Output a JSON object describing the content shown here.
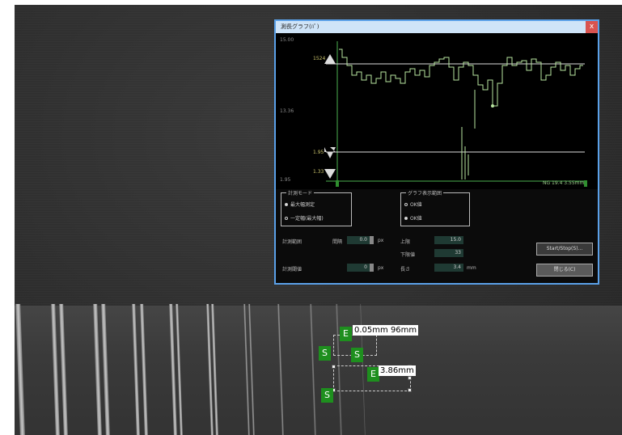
{
  "dialog": {
    "title": "測長グラフ(ﾊﾟ)",
    "close": "x"
  },
  "graph": {
    "y_top": "15.00",
    "y_mid": "13.36",
    "y_bottom": "1.95",
    "marker_upper": "1524",
    "marker_lower_1": "1.95",
    "marker_lower_2": "1.33",
    "status": "NG 19.4  3.55mm"
  },
  "panel": {
    "mode_group": {
      "title": "計測モード",
      "options": [
        "最大幅測定",
        "一定幅(最大幅)"
      ],
      "selected": 0
    },
    "graph_group": {
      "title": "グラフ表示範囲",
      "options": [
        "OK値",
        "OK値"
      ],
      "selected": 1
    },
    "params": {
      "range_label": "計測範囲",
      "interval_label": "間隔",
      "interval_value": "0.0",
      "threshold_label": "計測閾値",
      "threshold_value": "0",
      "unit_px": "px",
      "upper_label": "上限",
      "upper_value": "15.0",
      "lower_label": "下限値",
      "lower_value": "33",
      "length_label": "長さ",
      "length_value": "3.4",
      "unit_mm": "mm"
    },
    "buttons": {
      "start": "Start/Stop(S)...",
      "close": "閉じる(C)"
    }
  },
  "measurements": {
    "start_tag": "S",
    "end_tag": "E",
    "label1": "0.05mm",
    "label1_extra": "96mm",
    "label2": "3.86mm"
  }
}
